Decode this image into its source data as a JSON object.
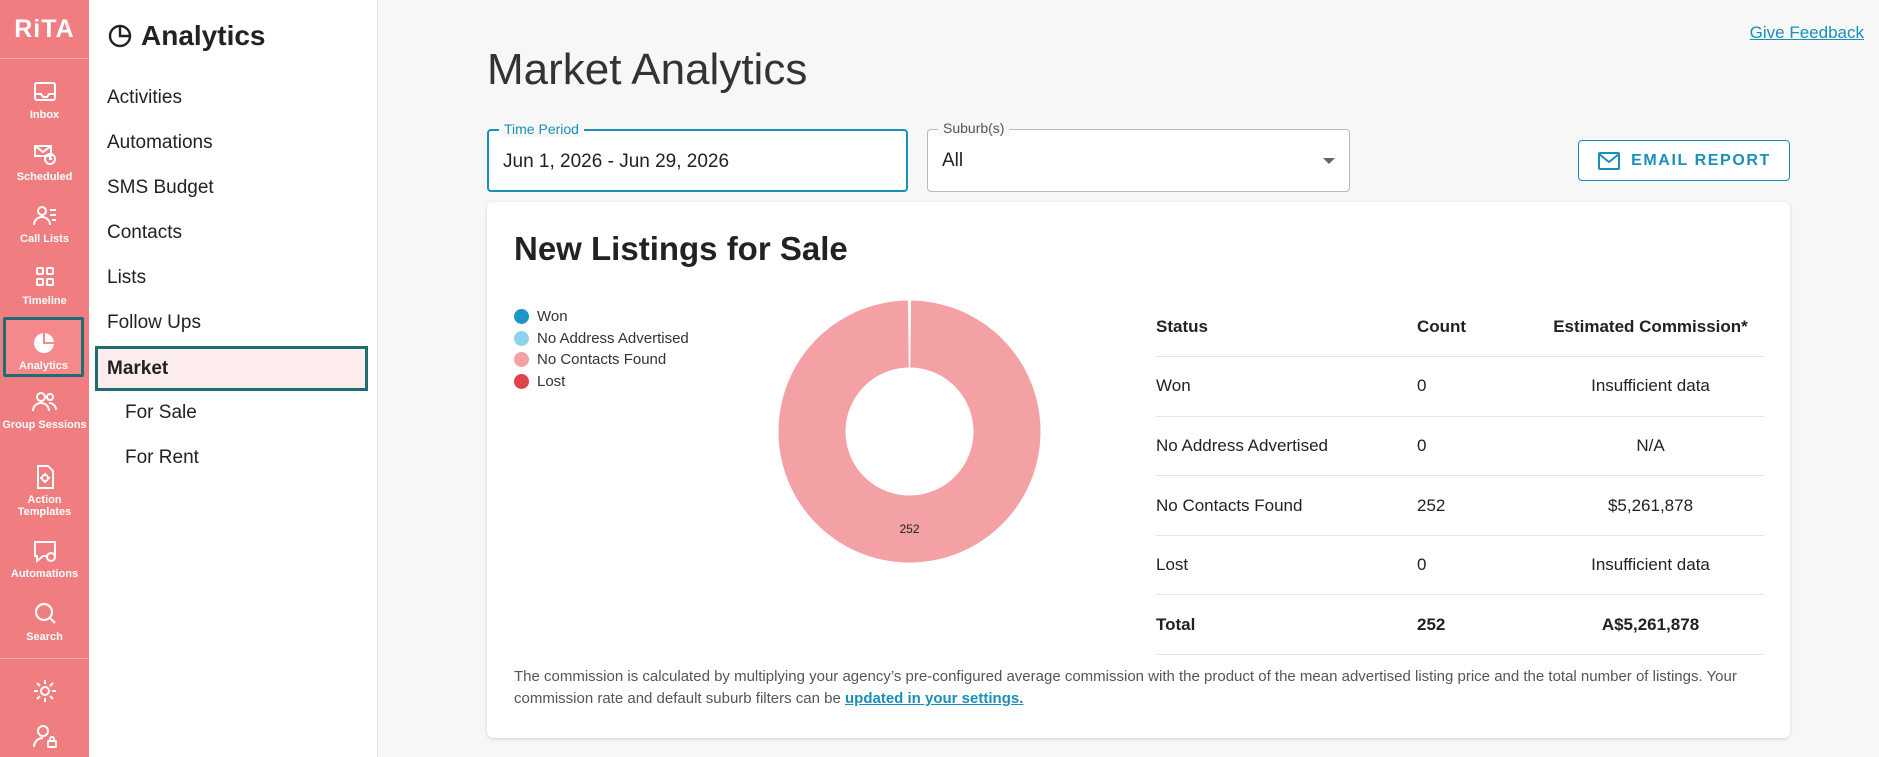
{
  "rail": {
    "logo": "RiTA",
    "items": [
      {
        "label": "Inbox",
        "icon": "inbox-icon"
      },
      {
        "label": "Scheduled",
        "icon": "scheduled-icon"
      },
      {
        "label": "Call Lists",
        "icon": "call-lists-icon"
      },
      {
        "label": "Timeline",
        "icon": "timeline-icon"
      },
      {
        "label": "Analytics",
        "icon": "analytics-icon"
      },
      {
        "label": "Group Sessions",
        "icon": "group-sessions-icon"
      },
      {
        "label": "Action Templates",
        "icon": "action-templates-icon"
      },
      {
        "label": "Automations",
        "icon": "automations-icon"
      },
      {
        "label": "Search",
        "icon": "search-icon"
      }
    ],
    "bottom_icons": [
      "settings-icon",
      "account-icon"
    ]
  },
  "subnav": {
    "title": "Analytics",
    "items": [
      "Activities",
      "Automations",
      "SMS Budget",
      "Contacts",
      "Lists",
      "Follow Ups",
      "Market",
      "For Sale",
      "For Rent"
    ]
  },
  "header": {
    "feedback": "Give Feedback",
    "title": "Market Analytics"
  },
  "filters": {
    "time_period": {
      "label": "Time Period",
      "value": "Jun 1, 2026 - Jun 29, 2026"
    },
    "suburbs": {
      "label": "Suburb(s)",
      "value": "All"
    },
    "email_button": "EMAIL REPORT"
  },
  "card": {
    "title": "New Listings for Sale",
    "legend": [
      {
        "name": "Won",
        "color": "#1e95c6"
      },
      {
        "name": "No Address Advertised",
        "color": "#8fd3ee"
      },
      {
        "name": "No Contacts Found",
        "color": "#f4a1a5"
      },
      {
        "name": "Lost",
        "color": "#e0434d"
      }
    ],
    "table": {
      "headers": [
        "Status",
        "Count",
        "Estimated Commission*"
      ],
      "rows": [
        [
          "Won",
          "0",
          "Insufficient data"
        ],
        [
          "No Address Advertised",
          "0",
          "N/A"
        ],
        [
          "No Contacts Found",
          "252",
          "$5,261,878"
        ],
        [
          "Lost",
          "0",
          "Insufficient data"
        ]
      ],
      "total": [
        "Total",
        "252",
        "A$5,261,878"
      ]
    },
    "note": "The commission is calculated by multiplying your agency’s pre-configured average commission with the product of the mean advertised listing price and the total number of listings. Your commission rate and default suburb filters can be ",
    "note_link": "updated in your settings."
  },
  "chart_data": {
    "type": "pie",
    "categories": [
      "Won",
      "No Address Advertised",
      "No Contacts Found",
      "Lost"
    ],
    "values": [
      0,
      0,
      252,
      0
    ],
    "colors": [
      "#1e95c6",
      "#8fd3ee",
      "#f4a1a5",
      "#e0434d"
    ],
    "data_labels": [
      "252"
    ],
    "legend": "left"
  },
  "colors": {
    "rail_bg": "#f07e80",
    "accent": "#1a8fb8",
    "active_outline": "#1f6c72"
  }
}
